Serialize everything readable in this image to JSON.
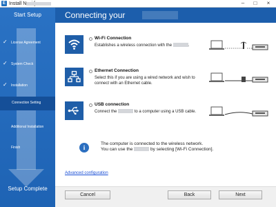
{
  "window": {
    "title": "Install Navi [",
    "controls": {
      "minimize": "–",
      "maximize": "□",
      "close": "×"
    }
  },
  "sidebar": {
    "title": "Start Setup",
    "footer": "Setup Complete",
    "steps": [
      {
        "label": "License Agreement",
        "done": true
      },
      {
        "label": "System Check",
        "done": true
      },
      {
        "label": "Installation",
        "done": true
      },
      {
        "label": "Connection Setting",
        "active": true
      },
      {
        "label": "Additional Installation"
      },
      {
        "label": "Finish"
      }
    ],
    "check_glyph": "✓"
  },
  "header": {
    "title": "Connecting your"
  },
  "options": [
    {
      "title": "Wi-Fi Connection",
      "desc_pre": "Establishes a wireless connection with the",
      "desc_post": ".",
      "icon": "wifi-icon"
    },
    {
      "title": "Ethernet Connection",
      "desc": "Select this if you are using a wired network and wish to connect with an Ethernet cable.",
      "icon": "ethernet-network-icon"
    },
    {
      "title": "USB connection",
      "desc_pre": "Connect the",
      "desc_post": "to a computer using a USB cable.",
      "icon": "usb-icon"
    }
  ],
  "info": {
    "line1": "The computer is connected to the wireless network.",
    "line2_pre": "You can use the",
    "line2_post": "by selecting [Wi-Fi Connection].",
    "glyph": "i"
  },
  "advanced_link": "Advanced configuration",
  "buttons": {
    "cancel": "Cancel",
    "back": "Back",
    "next": "Next"
  },
  "colors": {
    "sidebar": "#2a72c4",
    "header": "#1c5eac",
    "icon_bg": "#1f5ea8",
    "link": "#1a4fd6"
  }
}
